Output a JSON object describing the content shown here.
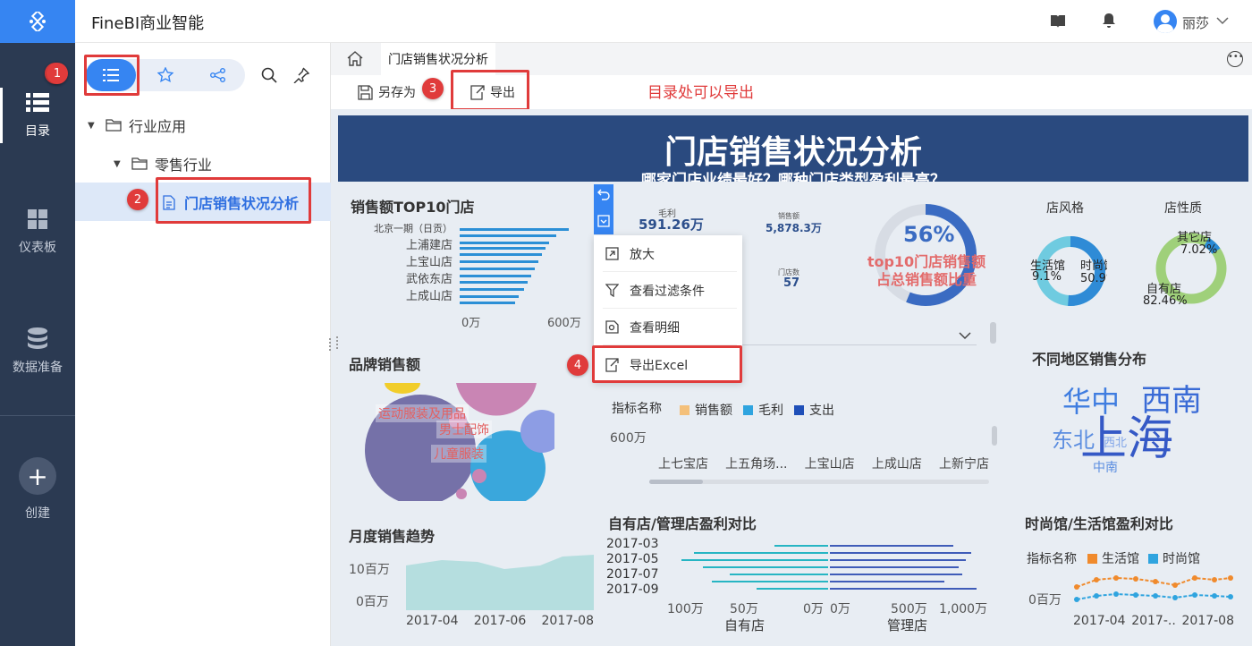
{
  "app": {
    "title": "FineBI商业智能",
    "user": "丽莎"
  },
  "rail": {
    "items": [
      {
        "label": "目录"
      },
      {
        "label": "仪表板"
      },
      {
        "label": "数据准备"
      },
      {
        "label": "创建"
      }
    ]
  },
  "tree": {
    "group": "行业应用",
    "subgroup": "零售行业",
    "report": "门店销售状况分析"
  },
  "tab": {
    "label": "门店销售状况分析"
  },
  "toolbar": {
    "save_as": "另存为",
    "export": "导出",
    "note": "目录处可以导出"
  },
  "badges": [
    "1",
    "2",
    "3",
    "4"
  ],
  "banner": {
    "title": "门店销售状况分析",
    "subtitle": "哪家门店业绩最好？哪种门店类型盈利最高？"
  },
  "top10": {
    "title": "销售额TOP10门店",
    "stores": [
      "北京一期（日贡）",
      "上浦建店",
      "上宝山店",
      "武依东店",
      "上成山店"
    ],
    "axis": [
      "0万",
      "600万"
    ]
  },
  "kpi": {
    "profit_label": "毛利",
    "profit": "591.26万",
    "sales_label": "销售额",
    "sales": "5,878.3万",
    "count_label": "门店数",
    "count": "57"
  },
  "gauge": {
    "value": "56%",
    "line1": "top10门店销售额",
    "line2": "占总销售额比重"
  },
  "style_pie": {
    "title": "店风格",
    "left": "生活馆",
    "left_pct": "9.1%",
    "right": "时尚馆",
    "right_pct": "50.9%"
  },
  "nature_pie": {
    "title": "店性质",
    "a": "其它店",
    "a_pct": "7.02%",
    "b": "自有店",
    "b_pct": "82.46%"
  },
  "menu": {
    "items": [
      "放大",
      "查看过滤条件",
      "查看明细",
      "导出Excel"
    ]
  },
  "brand": {
    "title": "品牌销售额",
    "labels": [
      "运动服装及用品",
      "男士配饰",
      "儿童服装"
    ]
  },
  "bar2": {
    "legend_title": "指标名称",
    "legend": [
      "销售额",
      "毛利",
      "支出"
    ],
    "ytick": "600万",
    "stores": [
      "上七宝店",
      "上五角场...",
      "上宝山店",
      "上成山店",
      "上新宁店"
    ]
  },
  "region": {
    "title": "不同地区销售分布",
    "words": [
      "华中",
      "西南",
      "上海",
      "东北",
      "西北",
      "中南"
    ]
  },
  "monthly": {
    "title": "月度销售趋势",
    "y": [
      "10百万",
      "0百万"
    ],
    "x": [
      "2017-04",
      "2017-06",
      "2017-08"
    ]
  },
  "compare": {
    "title": "自有店/管理店盈利对比",
    "months": [
      "2017-03",
      "2017-05",
      "2017-07",
      "2017-09"
    ],
    "left_ticks": [
      "100万",
      "50万",
      "0万"
    ],
    "right_ticks": [
      "0万",
      "500万",
      "1,000万"
    ],
    "left_label": "自有店",
    "right_label": "管理店"
  },
  "fashion": {
    "title": "时尚馆/生活馆盈利对比",
    "legend_title": "指标名称",
    "legend": [
      "生活馆",
      "时尚馆"
    ],
    "y": "0百万",
    "x": [
      "2017-04",
      "2017-..",
      "2017-08"
    ]
  },
  "colors": {
    "rail": "#2b3a52",
    "accent": "#3685f2",
    "banner": "#2a4a7f",
    "red": "#e03b3b"
  }
}
